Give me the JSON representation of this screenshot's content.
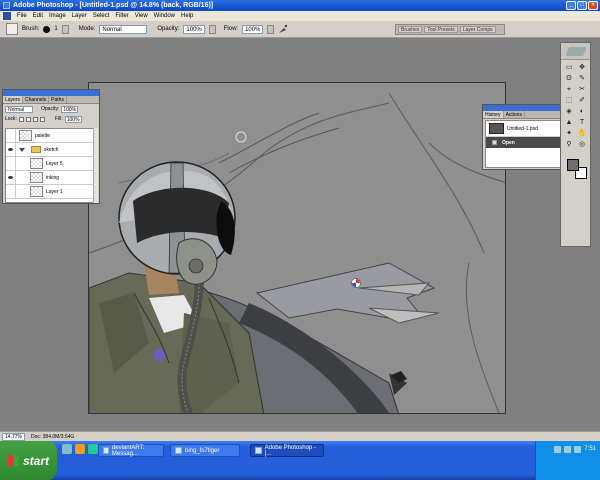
{
  "window": {
    "title": "Adobe Photoshop - [Untitled-1.psd @ 14.8% (back, RGB/16)]"
  },
  "menu": [
    "File",
    "Edit",
    "Image",
    "Layer",
    "Select",
    "Filter",
    "View",
    "Window",
    "Help"
  ],
  "options_bar": {
    "brush_label": "Brush:",
    "brush_size": "1",
    "mode_label": "Mode:",
    "mode_value": "Normal",
    "opacity_label": "Opacity:",
    "opacity_value": "100%",
    "flow_label": "Flow:",
    "flow_value": "100%"
  },
  "palette_well": [
    "Brushes",
    "Tool Presets",
    "Layer Comps"
  ],
  "layers_panel": {
    "tabs": [
      "Layers",
      "Channels",
      "Paths"
    ],
    "blend_mode": "Normal",
    "opacity_label": "Opacity:",
    "opacity_value": "100%",
    "lock_label": "Lock:",
    "fill_label": "Fill:",
    "fill_value": "100%",
    "layers": [
      "palette",
      "sketch",
      "Layer 5",
      "inking",
      "Layer 1"
    ]
  },
  "history_panel": {
    "tabs": [
      "History",
      "Actions"
    ],
    "snapshot": "Untitled-1.psd",
    "state": "Open"
  },
  "tools": [
    "▭",
    "✥",
    "ʘ",
    "✎",
    "⌖",
    "✂",
    "⬚",
    "✐",
    "◈",
    "◐",
    "▲",
    "T",
    "✦",
    "✋",
    "⚲",
    "◎"
  ],
  "colors": {
    "foreground": "#6e6e6e",
    "background": "#ffffff"
  },
  "status_bar": {
    "zoom": "14.77%",
    "doc_info": "Doc: 384.0M/3.54G"
  },
  "taskbar": {
    "start_label": "start",
    "tasks": [
      "deviantART: Messag...",
      "bing_fs7tiger",
      "Adobe Photoshop - [..."
    ],
    "clock": "7:51"
  }
}
